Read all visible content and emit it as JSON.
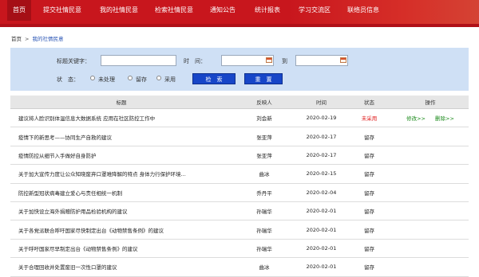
{
  "nav": {
    "items": [
      {
        "label": "首页",
        "active": true
      },
      {
        "label": "提交社情民意",
        "active": false
      },
      {
        "label": "我的社情民意",
        "active": false
      },
      {
        "label": "检索社情民意",
        "active": false
      },
      {
        "label": "通知公告",
        "active": false
      },
      {
        "label": "统计报表",
        "active": false
      },
      {
        "label": "学习交流区",
        "active": false
      },
      {
        "label": "联络员信息",
        "active": false
      }
    ]
  },
  "breadcrumb": {
    "home": "首页",
    "separator": ">",
    "current": "我的社情民意"
  },
  "filter": {
    "keyword_label": "标题关键字：",
    "keyword_value": "",
    "time_label": "时　间：",
    "date_from": "",
    "date_to": "",
    "to_label": "到",
    "status_label": "状　态：",
    "options": [
      "未处理",
      "留存",
      "采用"
    ],
    "search_button": "检　索",
    "reset_button": "重　置"
  },
  "table": {
    "headers": [
      "标题",
      "反映人",
      "时间",
      "状态",
      "操作"
    ],
    "rows": [
      {
        "title": "建议将人脸识别体温信息大数据系统 应用在社区防控工作中",
        "person": "刘会新",
        "date": "2020-02-19",
        "status": "未采用",
        "edit": "修改>>",
        "delete": "删除>>"
      },
      {
        "title": "疫情下的新思考——协同生产自救的建议",
        "person": "张亚萍",
        "date": "2020-02-17",
        "status": "留存",
        "edit": "",
        "delete": ""
      },
      {
        "title": "疫情防控从细节入手做好自身防护",
        "person": "张亚萍",
        "date": "2020-02-17",
        "status": "留存",
        "edit": "",
        "delete": ""
      },
      {
        "title": "关于加大宣传力度让公众知晓废弃口罩难降解的特点 身体力行保护环境...",
        "person": "曲冰",
        "date": "2020-02-15",
        "status": "留存",
        "edit": "",
        "delete": ""
      },
      {
        "title": "防控新型冠状病毒建立爱心与责任相统一机制",
        "person": "乔丹平",
        "date": "2020-02-04",
        "status": "留存",
        "edit": "",
        "delete": ""
      },
      {
        "title": "关于加快设立海外捐赠防护用品检验机构的建议",
        "person": "孙瑞华",
        "date": "2020-02-01",
        "status": "留存",
        "edit": "",
        "delete": ""
      },
      {
        "title": "关于各党派联合呼吁国家尽快制定出台《动物禁售条例》的建议",
        "person": "孙瑞华",
        "date": "2020-02-01",
        "status": "留存",
        "edit": "",
        "delete": ""
      },
      {
        "title": "关于呼吁国家尽早制定出台《动物禁售条例》的建议",
        "person": "孙瑞华",
        "date": "2020-02-01",
        "status": "留存",
        "edit": "",
        "delete": ""
      },
      {
        "title": "关于合理回收并处置废旧一次性口罩的建议",
        "person": "曲冰",
        "date": "2020-02-01",
        "status": "留存",
        "edit": "",
        "delete": ""
      }
    ]
  }
}
